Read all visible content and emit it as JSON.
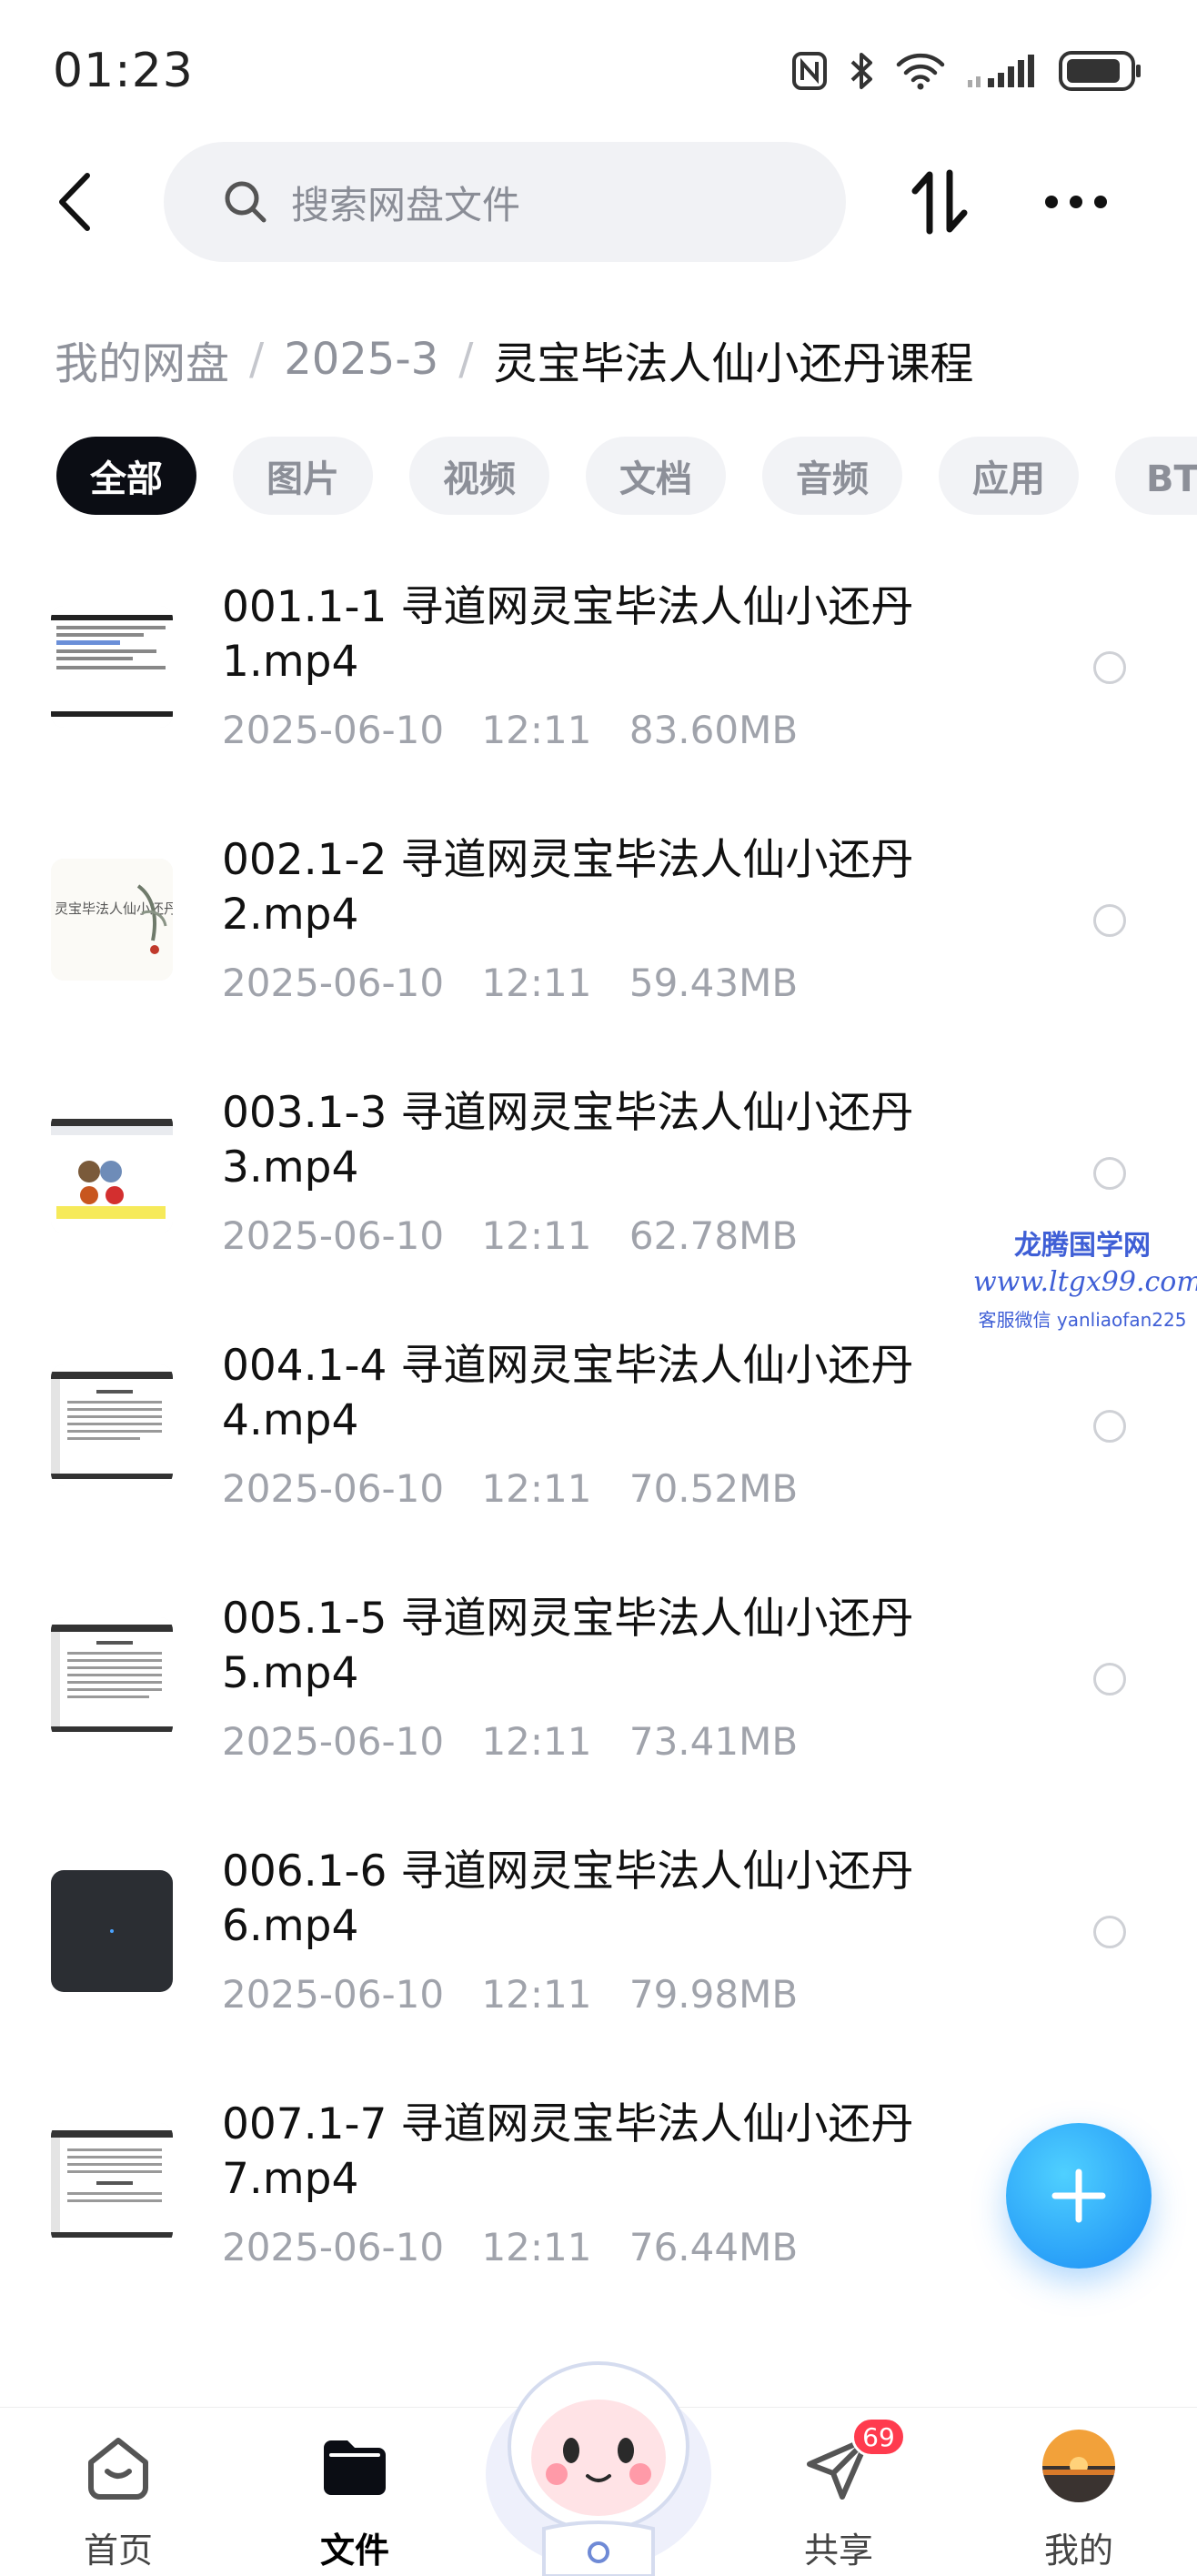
{
  "status_bar": {
    "time": "01:23"
  },
  "header": {
    "search_placeholder": "搜索网盘文件"
  },
  "breadcrumb": {
    "root": "我的网盘",
    "folder": "2025-3",
    "current": "灵宝毕法人仙小还丹课程"
  },
  "tabs": [
    {
      "label": "全部",
      "active": true
    },
    {
      "label": "图片"
    },
    {
      "label": "视频"
    },
    {
      "label": "文档"
    },
    {
      "label": "音频"
    },
    {
      "label": "应用"
    },
    {
      "label": "BT种子"
    }
  ],
  "files": [
    {
      "name": "001.1-1 寻道网灵宝毕法人仙小还丹1.mp4",
      "date": "2025-06-10",
      "time": "12:11",
      "size": "83.60MB",
      "thumb_text": ""
    },
    {
      "name": "002.1-2 寻道网灵宝毕法人仙小还丹2.mp4",
      "date": "2025-06-10",
      "time": "12:11",
      "size": "59.43MB",
      "thumb_text": "灵宝毕法人仙小还丹"
    },
    {
      "name": "003.1-3 寻道网灵宝毕法人仙小还丹3.mp4",
      "date": "2025-06-10",
      "time": "12:11",
      "size": "62.78MB",
      "thumb_text": ""
    },
    {
      "name": "004.1-4 寻道网灵宝毕法人仙小还丹4.mp4",
      "date": "2025-06-10",
      "time": "12:11",
      "size": "70.52MB",
      "thumb_text": ""
    },
    {
      "name": "005.1-5 寻道网灵宝毕法人仙小还丹5.mp4",
      "date": "2025-06-10",
      "time": "12:11",
      "size": "73.41MB",
      "thumb_text": ""
    },
    {
      "name": "006.1-6 寻道网灵宝毕法人仙小还丹6.mp4",
      "date": "2025-06-10",
      "time": "12:11",
      "size": "79.98MB",
      "thumb_text": ""
    },
    {
      "name": "007.1-7 寻道网灵宝毕法人仙小还丹7.mp4",
      "date": "2025-06-10",
      "time": "12:11",
      "size": "76.44MB",
      "thumb_text": ""
    }
  ],
  "watermark": {
    "title": "龙腾国学网",
    "url": "www.ltgx99.com",
    "contact": "客服微信 yanliaofan225"
  },
  "bottom_nav": {
    "home": "首页",
    "files": "文件",
    "share": "共享",
    "share_badge": "69",
    "mine": "我的"
  },
  "colors": {
    "accent": "#1a8cf5",
    "active_tab": "#0b0d14",
    "badge": "#ff3b4e"
  }
}
